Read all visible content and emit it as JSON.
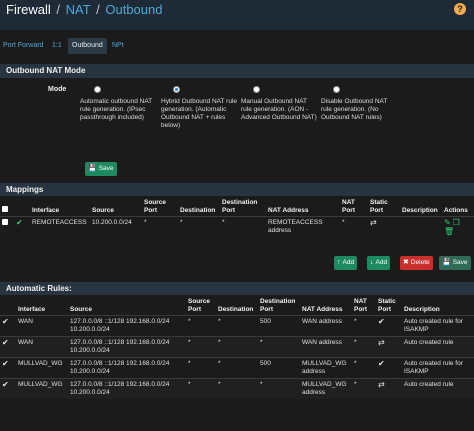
{
  "breadcrumb": {
    "part1": "Firewall",
    "part2": "NAT",
    "part3": "Outbound",
    "sep": "/"
  },
  "help_icon": "?",
  "tabs": [
    {
      "label": "Port Forward",
      "active": false
    },
    {
      "label": "1:1",
      "active": false
    },
    {
      "label": "Outbound",
      "active": true
    },
    {
      "label": "NPt",
      "active": false
    }
  ],
  "outbound_mode": {
    "title": "Outbound NAT Mode",
    "mode_label": "Mode",
    "options": [
      {
        "text": "Automatic outbound NAT rule generation. (IPsec passthrough included)",
        "selected": false
      },
      {
        "text": "Hybrid Outbound NAT rule generation. (Automatic Outbound NAT + rules below)",
        "selected": true
      },
      {
        "text": "Manual Outbound NAT rule generation. (AON - Advanced Outbound NAT)",
        "selected": false
      },
      {
        "text": "Disable Outbound NAT rule generation. (No Outbound NAT rules)",
        "selected": false
      }
    ],
    "save_label": "Save"
  },
  "mappings": {
    "title": "Mappings",
    "columns": [
      "",
      "Interface",
      "Source",
      "Source Port",
      "Destination",
      "Destination Port",
      "NAT Address",
      "NAT Port",
      "Static Port",
      "Description",
      "Actions"
    ],
    "rows": [
      {
        "interface": "REMOTEACCESS",
        "source": "10.200.0.0/24",
        "source_port": "*",
        "destination": "*",
        "destination_port": "*",
        "nat_address": "REMOTEACCESS address",
        "nat_port": "*",
        "description": ""
      }
    ],
    "buttons": {
      "add_top": "Add",
      "add_bottom": "Add",
      "delete": "Delete",
      "save": "Save"
    }
  },
  "automatic_rules": {
    "title": "Automatic Rules:",
    "columns": [
      "",
      "Interface",
      "Source",
      "Source Port",
      "Destination",
      "Destination Port",
      "NAT Address",
      "NAT Port",
      "Static Port",
      "Description"
    ],
    "rows": [
      {
        "interface": "WAN",
        "source": "127.0.0.0/8 ::1/128 192.168.0.0/24 10.200.0.0/24",
        "source_port": "*",
        "destination": "*",
        "destination_port": "500",
        "nat_address": "WAN address",
        "nat_port": "*",
        "description": "Auto created rule for ISAKMP"
      },
      {
        "interface": "WAN",
        "source": "127.0.0.0/8 ::1/128 192.168.0.0/24 10.200.0.0/24",
        "source_port": "*",
        "destination": "*",
        "destination_port": "*",
        "nat_address": "WAN address",
        "nat_port": "*",
        "description": "Auto created rule"
      },
      {
        "interface": "MULLVAD_WG",
        "source": "127.0.0.0/8 ::1/128 192.168.0.0/24 10.200.0.0/24",
        "source_port": "*",
        "destination": "*",
        "destination_port": "500",
        "nat_address": "MULLVAD_WG address",
        "nat_port": "*",
        "description": "Auto created rule for ISAKMP"
      },
      {
        "interface": "MULLVAD_WG",
        "source": "127.0.0.0/8 ::1/128 192.168.0.0/24 10.200.0.0/24",
        "source_port": "*",
        "destination": "*",
        "destination_port": "*",
        "nat_address": "MULLVAD_WG address",
        "nat_port": "*",
        "description": "Auto created rule"
      }
    ]
  },
  "icons": {
    "enabled": "check-icon",
    "static_port": "shuffle-icon",
    "edit": "pencil-icon",
    "copy": "copy-icon",
    "delete": "trash-icon",
    "add": "arrow-up-icon",
    "save": "save-icon"
  },
  "colors": {
    "accent": "#4fa8da",
    "success": "#1e8a5f",
    "danger": "#c9302c",
    "header_bg": "#283540"
  }
}
